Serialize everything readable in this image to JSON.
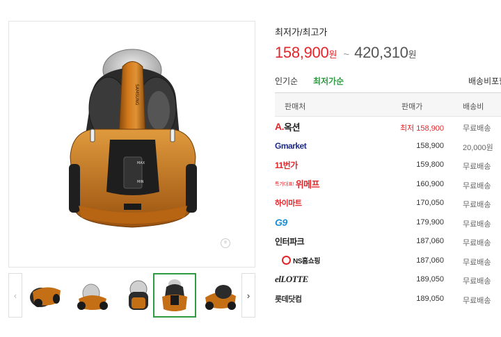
{
  "product": {
    "brand_on_device": "SAMSUNG",
    "dial_max": "MAX",
    "dial_min": "MIN",
    "watermark": "ㅎ"
  },
  "price": {
    "label": "최저가/최고가",
    "min": "158,900",
    "max": "420,310",
    "unit": "원",
    "separator": "~"
  },
  "sort_tabs": [
    {
      "label": "인기순",
      "active": false
    },
    {
      "label": "최저가순",
      "active": true
    },
    {
      "label": "배송비포함",
      "active": false
    }
  ],
  "table": {
    "headers": {
      "seller": "판매처",
      "price": "판매가",
      "shipping": "배송비"
    },
    "rows": [
      {
        "seller": "옥션",
        "logo_prefix": "A.",
        "price": "최저 158,900",
        "shipping": "무료배송",
        "lowest": true
      },
      {
        "seller": "Gmarket",
        "price": "158,900",
        "shipping": "20,000원",
        "lowest": false
      },
      {
        "seller": "11번가",
        "price": "159,800",
        "shipping": "무료배송",
        "lowest": false
      },
      {
        "seller": "위메프",
        "logo_prefix": "특가대표!",
        "price": "160,900",
        "shipping": "무료배송",
        "lowest": false
      },
      {
        "seller": "하이마트",
        "price": "170,050",
        "shipping": "무료배송",
        "lowest": false
      },
      {
        "seller": "G9",
        "price": "179,900",
        "shipping": "무료배송",
        "lowest": false
      },
      {
        "seller": "인터파크",
        "price": "187,060",
        "shipping": "무료배송",
        "lowest": false
      },
      {
        "seller": "NS홈쇼핑",
        "price": "187,060",
        "shipping": "무료배송",
        "lowest": false
      },
      {
        "seller": "elLOTTE",
        "price": "189,050",
        "shipping": "무료배송",
        "lowest": false
      },
      {
        "seller": "롯데닷컴",
        "price": "189,050",
        "shipping": "무료배송",
        "lowest": false
      }
    ]
  },
  "thumbnails": {
    "prev_icon": "‹",
    "next_icon": "›",
    "count": 5,
    "selected_index": 3
  },
  "colors": {
    "price_red": "#e2262a",
    "active_green": "#2e9b42",
    "product_orange": "#c46e15"
  }
}
